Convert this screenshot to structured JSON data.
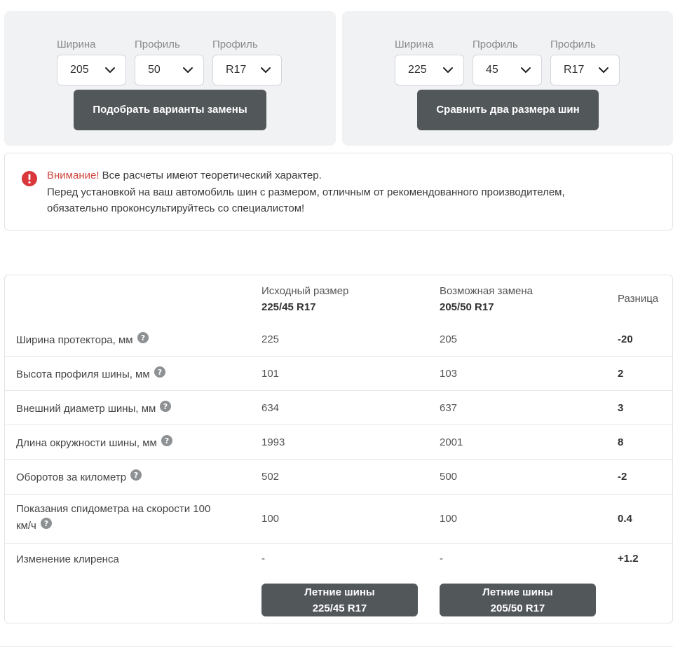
{
  "left_panel": {
    "selects": [
      {
        "label": "Ширина",
        "value": "205"
      },
      {
        "label": "Профиль",
        "value": "50"
      },
      {
        "label": "Профиль",
        "value": "R17"
      }
    ],
    "button_label": "Подобрать варианты замены"
  },
  "right_panel": {
    "selects": [
      {
        "label": "Ширина",
        "value": "225"
      },
      {
        "label": "Профиль",
        "value": "45"
      },
      {
        "label": "Профиль",
        "value": "R17"
      }
    ],
    "button_label": "Сравнить два размера шин"
  },
  "warning": {
    "accent": "Внимание!",
    "line1": " Все расчеты имеют теоретический характер.",
    "line2": "Перед установкой на ваш автомобиль шин с размером, отличным от рекомендованного производителем,",
    "line3": "обязательно проконсультируйтесь со специалистом!",
    "icon": "alert-icon",
    "accent_color": "#d0463f"
  },
  "table": {
    "headers": {
      "original_title": "Исходный размер",
      "original_size": "225/45 R17",
      "replacement_title": "Возможная замена",
      "replacement_size": "205/50 R17",
      "diff_title": "Разница"
    },
    "rows": [
      {
        "label": "Ширина протектора, мм",
        "original": "225",
        "replacement": "205",
        "diff": "-20"
      },
      {
        "label": "Высота профиля шины, мм",
        "original": "101",
        "replacement": "103",
        "diff": "2"
      },
      {
        "label": "Внешний диаметр шины, мм",
        "original": "634",
        "replacement": "637",
        "diff": "3"
      },
      {
        "label": "Длина окружности шины, мм",
        "original": "1993",
        "replacement": "2001",
        "diff": "8"
      },
      {
        "label": "Оборотов за километр",
        "original": "502",
        "replacement": "500",
        "diff": "-2"
      },
      {
        "label_line1": "Показания спидометра на скорости 100",
        "label_line2": "км/ч",
        "original": "100",
        "replacement": "100",
        "diff": "0.4"
      },
      {
        "label": "Изменение клиренса",
        "original": "-",
        "replacement": "-",
        "diff": "+1.2"
      }
    ],
    "buttons": [
      {
        "line1": "Летние шины",
        "line2": "225/45 R17"
      },
      {
        "line1": "Летние шины",
        "line2": "205/50 R17"
      }
    ]
  },
  "colors": {
    "button_dark": "#52575a",
    "panel_bg": "#f1f2f4"
  }
}
